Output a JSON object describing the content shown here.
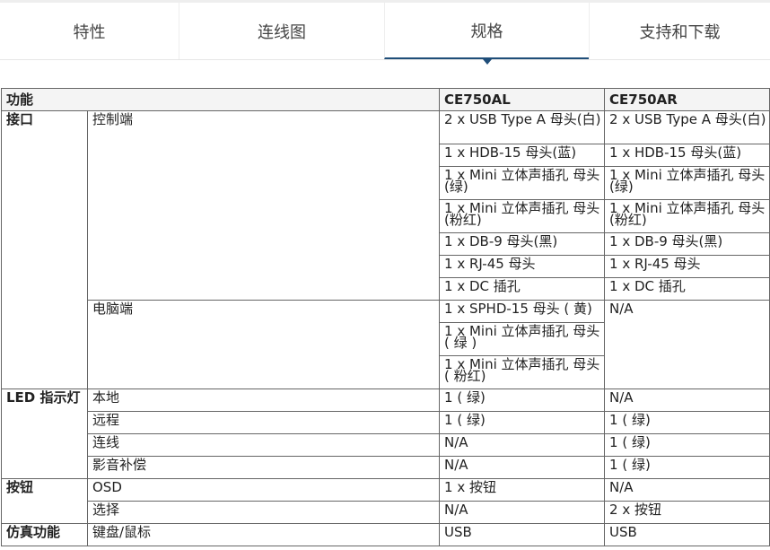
{
  "tabs": [
    {
      "label": "特性"
    },
    {
      "label": "连线图"
    },
    {
      "label": "规格"
    },
    {
      "label": "支持和下载"
    }
  ],
  "table": {
    "headers": {
      "function": "功能",
      "model_a": "CE750AL",
      "model_b": "CE750AR"
    },
    "interface": {
      "label": "接口",
      "console_label": "控制端",
      "console_rows": [
        [
          "2 x USB Type A 母头(白)",
          "2 x USB Type A 母头(白)"
        ],
        [
          "1 x HDB-15 母头(蓝)",
          "1 x HDB-15 母头(蓝)"
        ],
        [
          "1 x Mini 立体声插孔 母头(绿)",
          "1 x Mini 立体声插孔 母头(绿)"
        ],
        [
          "1 x Mini 立体声插孔 母头(粉红)",
          "1 x Mini 立体声插孔 母头(粉红)"
        ],
        [
          "1 x DB-9 母头(黑)",
          "1 x DB-9 母头(黑)"
        ],
        [
          "1 x RJ-45 母头",
          "1 x RJ-45 母头"
        ],
        [
          "1 x DC 插孔",
          "1 x DC 插孔"
        ]
      ],
      "computer_label": "电脑端",
      "computer_rows_a": [
        "1 x SPHD-15 母头 ( 黄)",
        "1 x Mini 立体声插孔 母头 ( 绿 )",
        "1 x Mini 立体声插孔 母头 ( 粉红)"
      ],
      "computer_b": "N/A"
    },
    "led": {
      "label": "LED 指示灯",
      "rows": [
        {
          "name": "本地",
          "a": "1 ( 绿)",
          "b": "N/A"
        },
        {
          "name": "远程",
          "a": "1 ( 绿)",
          "b": "1 ( 绿)"
        },
        {
          "name": "连线",
          "a": "N/A",
          "b": "1 ( 绿)"
        },
        {
          "name": "影音补偿",
          "a": "N/A",
          "b": "1 ( 绿)"
        }
      ]
    },
    "buttons": {
      "label": "按钮",
      "rows": [
        {
          "name": "OSD",
          "a": "1 x 按钮",
          "b": "N/A"
        },
        {
          "name": "选择",
          "a": "N/A",
          "b": "2 x 按钮"
        }
      ]
    },
    "emulation": {
      "label": "仿真功能",
      "rows": [
        {
          "name": "键盘/鼠标",
          "a": "USB",
          "b": "USB"
        }
      ]
    }
  }
}
